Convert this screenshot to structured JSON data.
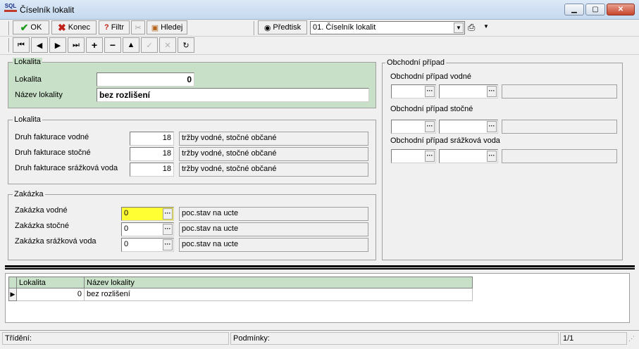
{
  "window": {
    "title": "Číselník lokalit"
  },
  "toolbar": {
    "ok_label": "OK",
    "konec_label": "Konec",
    "filtr_label": "Filtr",
    "hledej_label": "Hledej",
    "predtisk_label": "Předtisk",
    "report_select_value": "01. Číselník lokalit"
  },
  "lokalita_group": {
    "title": "Lokalita",
    "lokalita_label": "Lokalita",
    "lokalita_value": "0",
    "nazev_label": "Název lokality",
    "nazev_value": "bez rozlišení"
  },
  "fakturace_group": {
    "title": "Lokalita",
    "rows": [
      {
        "label": "Druh fakturace vodné",
        "value": "18",
        "desc": "tržby vodné, stočné občané"
      },
      {
        "label": "Druh fakturace stočné",
        "value": "18",
        "desc": "tržby vodné, stočné občané"
      },
      {
        "label": "Druh fakturace srážková voda",
        "value": "18",
        "desc": "tržby vodné, stočné občané"
      }
    ]
  },
  "zakazka_group": {
    "title": "Zakázka",
    "rows": [
      {
        "label": "Zakázka vodné",
        "value": "0",
        "desc": "poc.stav na ucte"
      },
      {
        "label": "Zakázka stočné",
        "value": "0",
        "desc": "poc.stav na ucte"
      },
      {
        "label": "Zakázka srážková voda",
        "value": "0",
        "desc": "poc.stav na ucte"
      }
    ]
  },
  "obchodni_group": {
    "title": "Obchodní případ",
    "rows": [
      {
        "label": "Obchodní případ vodné"
      },
      {
        "label": "Obchodní případ stočné"
      },
      {
        "label": "Obchodní případ srážková voda"
      }
    ]
  },
  "grid": {
    "columns": [
      "Lokalita",
      "Název lokality"
    ],
    "rows": [
      {
        "lokalita": "0",
        "nazev": "bez rozlišení"
      }
    ]
  },
  "statusbar": {
    "trideni_label": "Třídění:",
    "podminky_label": "Podmínky:",
    "page": "1/1"
  },
  "colors": {
    "lokalita_group_bg": "#c7e0c7",
    "grid_header_bg": "#c7e0c7",
    "focused_input_bg": "#ffff33"
  }
}
